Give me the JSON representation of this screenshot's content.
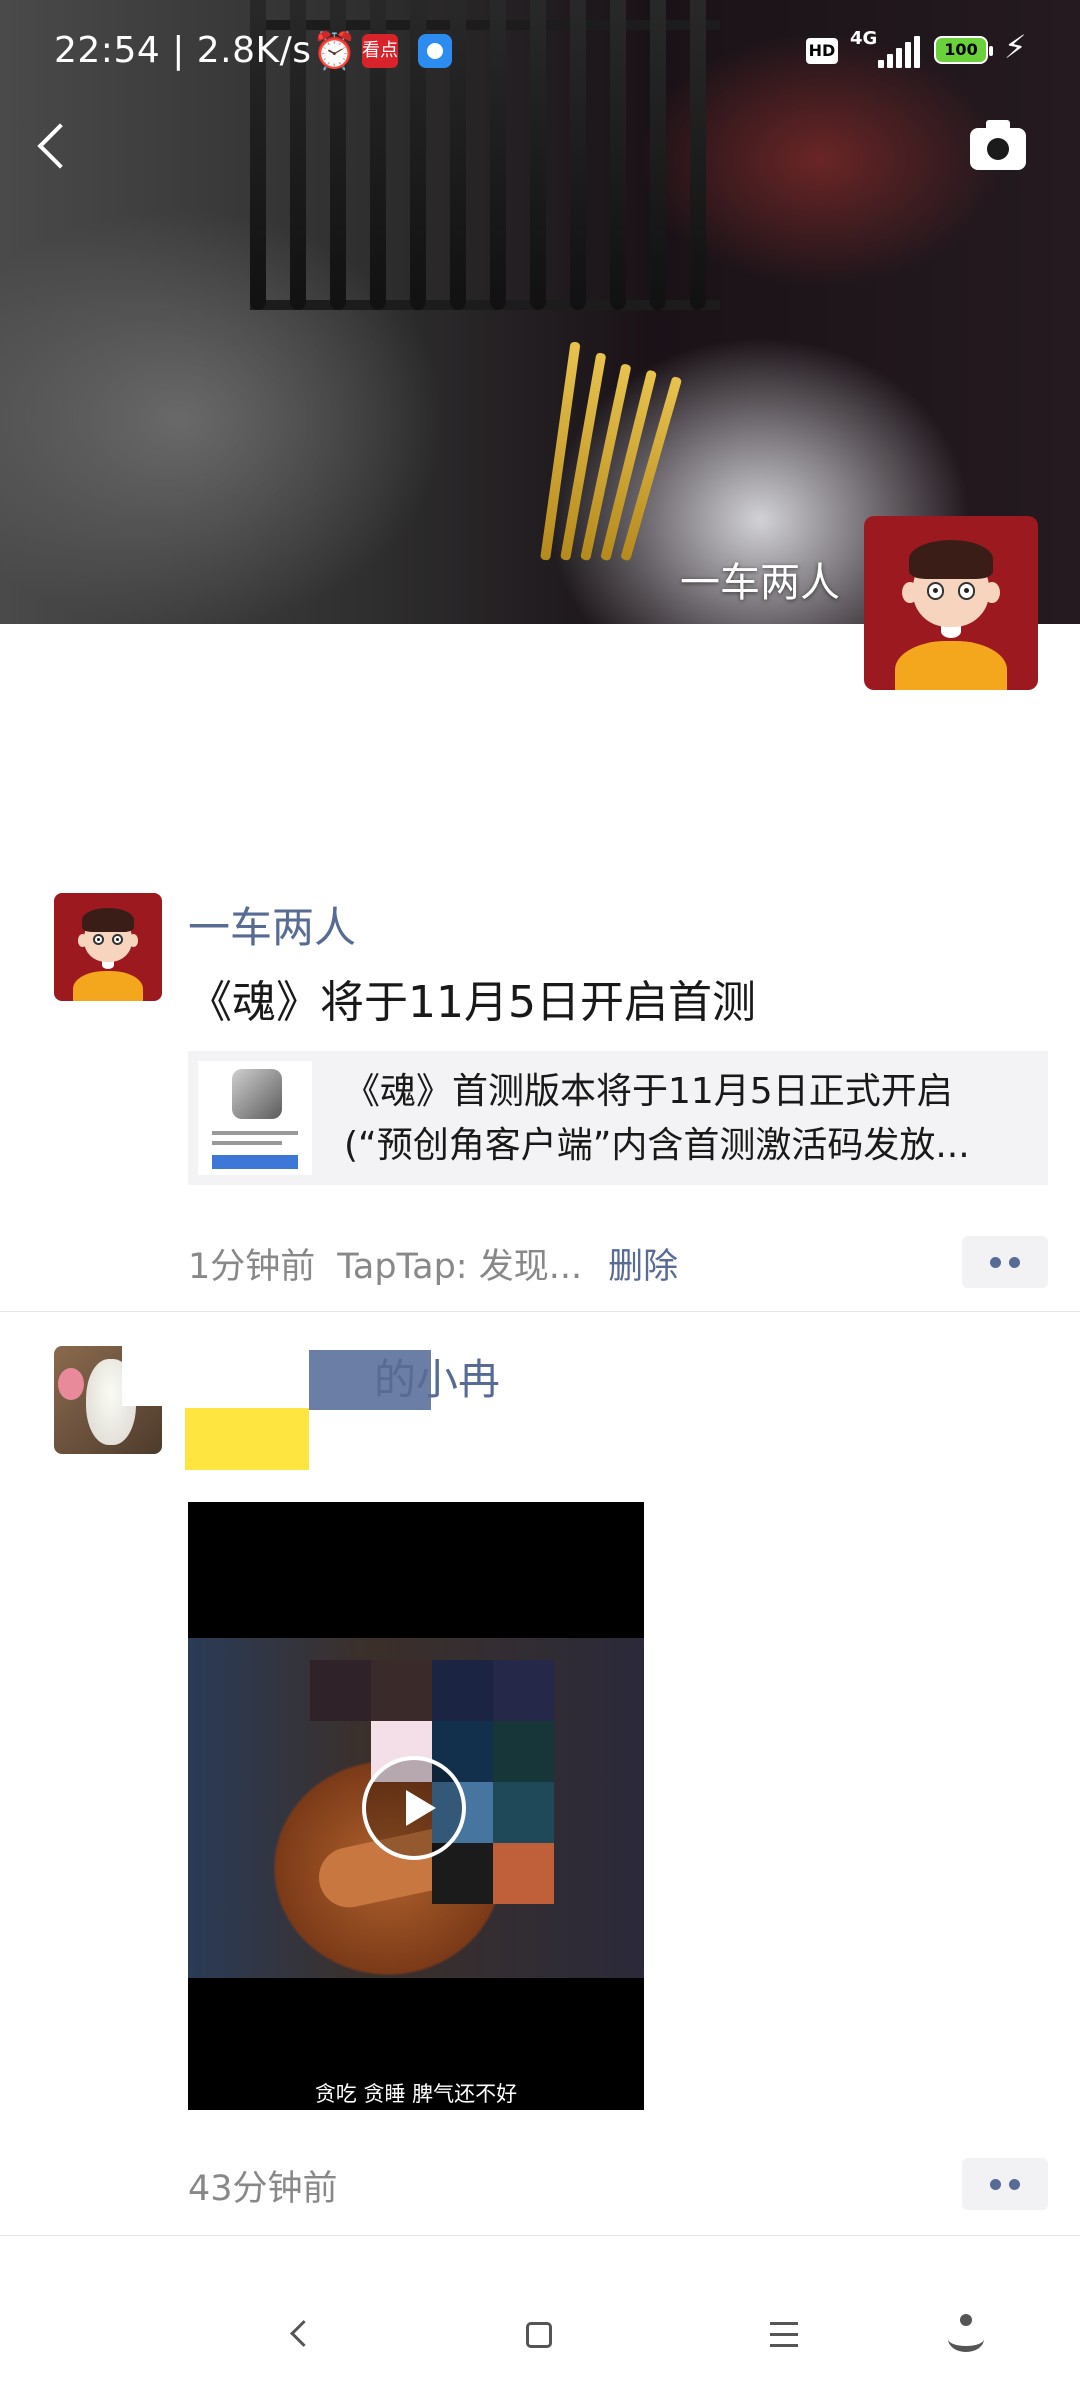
{
  "status_bar": {
    "time": "22:54",
    "network_speed": "2.8K/s",
    "hd_badge": "HD",
    "network_type": "4G",
    "battery_level": "100",
    "notification_app_label": "看点"
  },
  "cover": {
    "owner_name": "一车两人"
  },
  "posts": [
    {
      "nickname": "一车两人",
      "text": "《魂》将于11月5日开启首测",
      "link": {
        "title_line1": "《魂》首测版本将于11月5日正式开启",
        "title_line2": "(“预创角客户端”内含首测激活码发放..."
      },
      "time": "1分钟前",
      "source": "TapTap: 发现...",
      "delete_label": "删除"
    },
    {
      "nickname": "的小冉",
      "video_subtitle": "贪吃 贪睡 脾气还不好",
      "time": "43分钟前"
    }
  ],
  "colors": {
    "link_blue": "#576b95",
    "meta_gray": "#888888",
    "card_bg": "#f3f3f5"
  }
}
